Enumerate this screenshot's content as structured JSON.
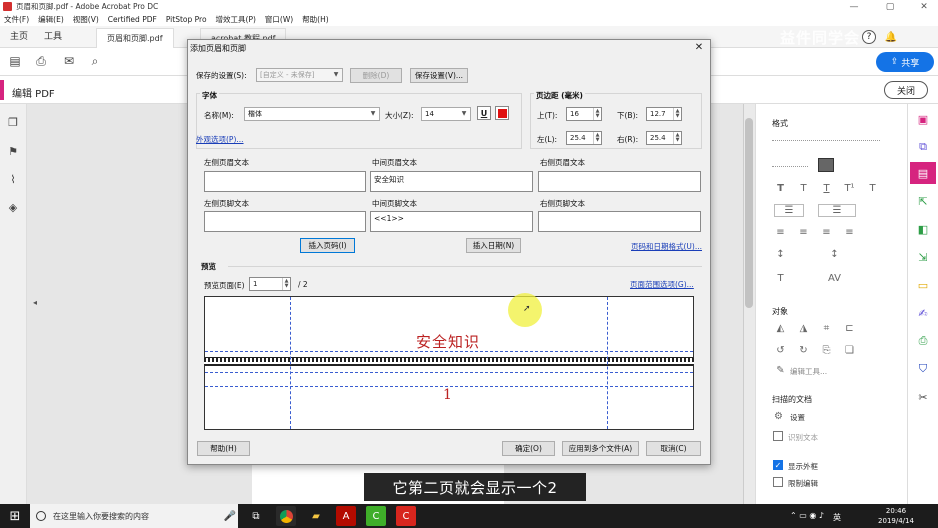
{
  "window": {
    "title": "页眉和页脚.pdf - Adobe Acrobat Pro DC",
    "menus": [
      "文件(F)",
      "编辑(E)",
      "视图(V)",
      "Certified PDF",
      "PitStop Pro",
      "增效工具(P)",
      "窗口(W)",
      "帮助(H)"
    ]
  },
  "tabs": {
    "home": "主页",
    "tools": "工具",
    "doc1": "页眉和页脚.pdf",
    "doc2": "acrobat 教程.pdf"
  },
  "watermark": "益件同学会",
  "share_label": "共享",
  "edit_panel": {
    "label": "编辑 PDF",
    "close_label": "关闭"
  },
  "dialog": {
    "title": "添加页眉和页脚",
    "saved_settings_label": "保存的设置(S):",
    "saved_settings_value": "[自定义 - 未保存]",
    "delete_label": "删除(D)",
    "save_settings_label": "保存设置(V)...",
    "font_group": "字体",
    "name_label": "名称(M):",
    "font_name": "楷体",
    "size_label": "大小(Z):",
    "font_size": "14",
    "underline_glyph": "U",
    "appearance_link": "外观选项(P)...",
    "margin_group": "页边距 (毫米)",
    "top_label": "上(T):",
    "top_value": "16",
    "bottom_label": "下(B):",
    "bottom_value": "12.7",
    "left_label": "左(L):",
    "left_value": "25.4",
    "right_label": "右(R):",
    "right_value": "25.4",
    "left_header_label": "左侧页眉文本",
    "center_header_label": "中间页眉文本",
    "right_header_label": "右侧页眉文本",
    "center_header_value": "安全知识",
    "left_footer_label": "左侧页脚文本",
    "center_footer_label": "中间页脚文本",
    "right_footer_label": "右侧页脚文本",
    "center_footer_value": "<<1>>",
    "insert_page_label": "插入页码(I)",
    "insert_date_label": "插入日期(N)",
    "page_date_format_link": "页码和日期格式(U)...",
    "preview_title": "预览",
    "preview_page_label": "预览页面(E)",
    "preview_page_value": "1",
    "preview_total": "/ 2",
    "page_range_link": "页面范围选项(G)...",
    "preview_header_text": "安全知识",
    "preview_footer_text": "1",
    "help_label": "帮助(H)",
    "ok_label": "确定(O)",
    "apply_multi_label": "应用到多个文件(A)",
    "cancel_label": "取消(C)"
  },
  "right_panel": {
    "format_title": "格式",
    "objects_title": "对象",
    "edit_tools_label": "编辑工具...",
    "scanned_title": "扫描的文档",
    "settings_label": "设置",
    "recognize_label": "识别文本",
    "show_bbox_label": "显示外框",
    "show_bbox_checked": true,
    "restrict_label": "限制编辑",
    "restrict_checked": false
  },
  "subtitle": "它第二页就会显示一个2",
  "taskbar": {
    "search_placeholder": "在这里输入你要搜索的内容",
    "ime": "英",
    "time": "20:46",
    "date": "2019/4/14"
  },
  "colors": {
    "accent_pink": "#d6247f",
    "acrobat_blue": "#1473e6",
    "preview_text_red": "#b22222",
    "guide_blue": "#3a5dd0"
  }
}
